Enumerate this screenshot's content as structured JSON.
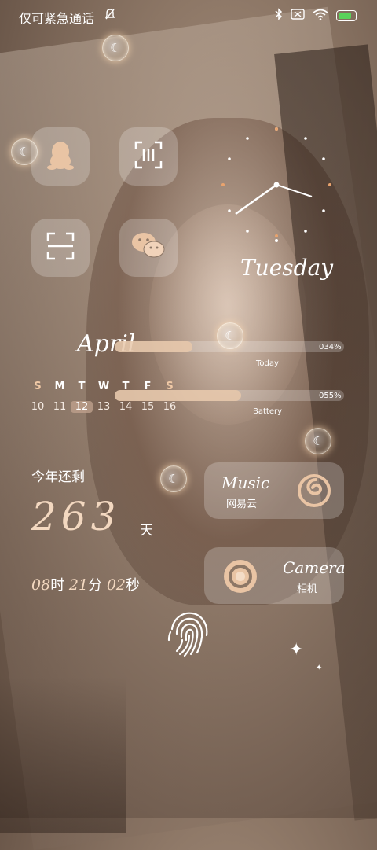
{
  "status_bar": {
    "carrier": "仅可紧急通话",
    "icons": [
      "mute-bell-icon",
      "bluetooth-icon",
      "no-sim-icon",
      "wifi-icon",
      "battery-charging-icon"
    ]
  },
  "apps": [
    {
      "name": "QQ",
      "icon": "penguin-icon"
    },
    {
      "name": "Scanner",
      "icon": "barcode-scan-icon"
    },
    {
      "name": "Scan",
      "icon": "scan-frame-icon"
    },
    {
      "name": "WeChat",
      "icon": "wechat-icon"
    }
  ],
  "clock": {
    "weekday": "Tuesday"
  },
  "month": {
    "name": "April"
  },
  "progress": {
    "today": {
      "label": "Today",
      "percent_text": "034%",
      "value": 0.34
    },
    "battery": {
      "label": "Battery",
      "percent_text": "055%",
      "value": 0.55
    }
  },
  "calendar": {
    "weekdays": [
      "S",
      "M",
      "T",
      "W",
      "T",
      "F",
      "S"
    ],
    "days": [
      "10",
      "11",
      "12",
      "13",
      "14",
      "15",
      "16"
    ],
    "today_index": 2
  },
  "countdown": {
    "label": "今年还剩",
    "days": "263",
    "unit": "天",
    "hours": "08",
    "hours_unit": "时",
    "minutes": "21",
    "minutes_unit": "分",
    "seconds": "02",
    "seconds_unit": "秒"
  },
  "widgets": {
    "music": {
      "title": "Music",
      "subtitle": "网易云",
      "icon": "netease-music-icon"
    },
    "camera": {
      "title": "Camera",
      "subtitle": "相机",
      "icon": "camera-lens-icon"
    }
  },
  "colors": {
    "accent": "#f3d8c0",
    "tile": "#ffffff38",
    "bar_fill": "#e8c8aa"
  }
}
